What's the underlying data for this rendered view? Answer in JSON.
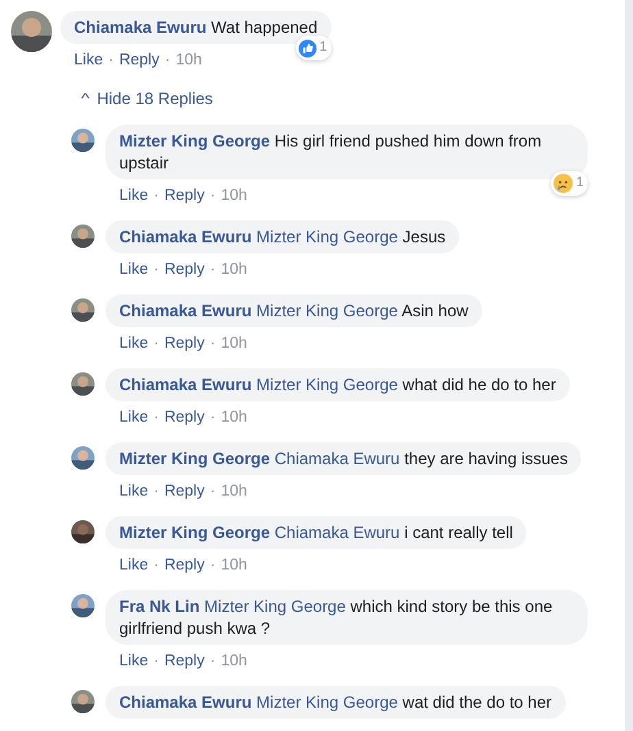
{
  "sep": "·",
  "comment": {
    "author": "Chiamaka Ewuru",
    "text": "Wat happened",
    "actions": [
      "Like",
      "Reply"
    ],
    "time": "10h",
    "reaction": {
      "kind": "like",
      "count": "1"
    }
  },
  "replies_toggle": {
    "icon": "^",
    "label": "Hide 18 Replies"
  },
  "replies": [
    {
      "author": "Mizter King George",
      "text": "His girl friend pushed him down from upstair",
      "actions": [
        "Like",
        "Reply"
      ],
      "time": "10h",
      "reaction": {
        "kind": "sad",
        "count": "1"
      }
    },
    {
      "author": "Chiamaka Ewuru",
      "mention": "Mizter King George",
      "text": "Jesus",
      "actions": [
        "Like",
        "Reply"
      ],
      "time": "10h"
    },
    {
      "author": "Chiamaka Ewuru",
      "mention": "Mizter King George",
      "text": "Asin how",
      "actions": [
        "Like",
        "Reply"
      ],
      "time": "10h"
    },
    {
      "author": "Chiamaka Ewuru",
      "mention": "Mizter King George",
      "text": "what did he do to her",
      "actions": [
        "Like",
        "Reply"
      ],
      "time": "10h"
    },
    {
      "author": "Mizter King George",
      "mention": "Chiamaka Ewuru",
      "text": "they are having issues",
      "actions": [
        "Like",
        "Reply"
      ],
      "time": "10h"
    },
    {
      "author": "Mizter King George",
      "mention": "Chiamaka Ewuru",
      "text": "i cant really tell",
      "actions": [
        "Like",
        "Reply"
      ],
      "time": "10h"
    },
    {
      "author": "Fra Nk Lin",
      "mention": "Mizter King George",
      "text": "which kind story be this one girlfriend push kwa ?",
      "actions": [
        "Like",
        "Reply"
      ],
      "time": "10h"
    },
    {
      "author": "Chiamaka Ewuru",
      "mention": "Mizter King George",
      "text": "wat did the do to her"
    }
  ]
}
